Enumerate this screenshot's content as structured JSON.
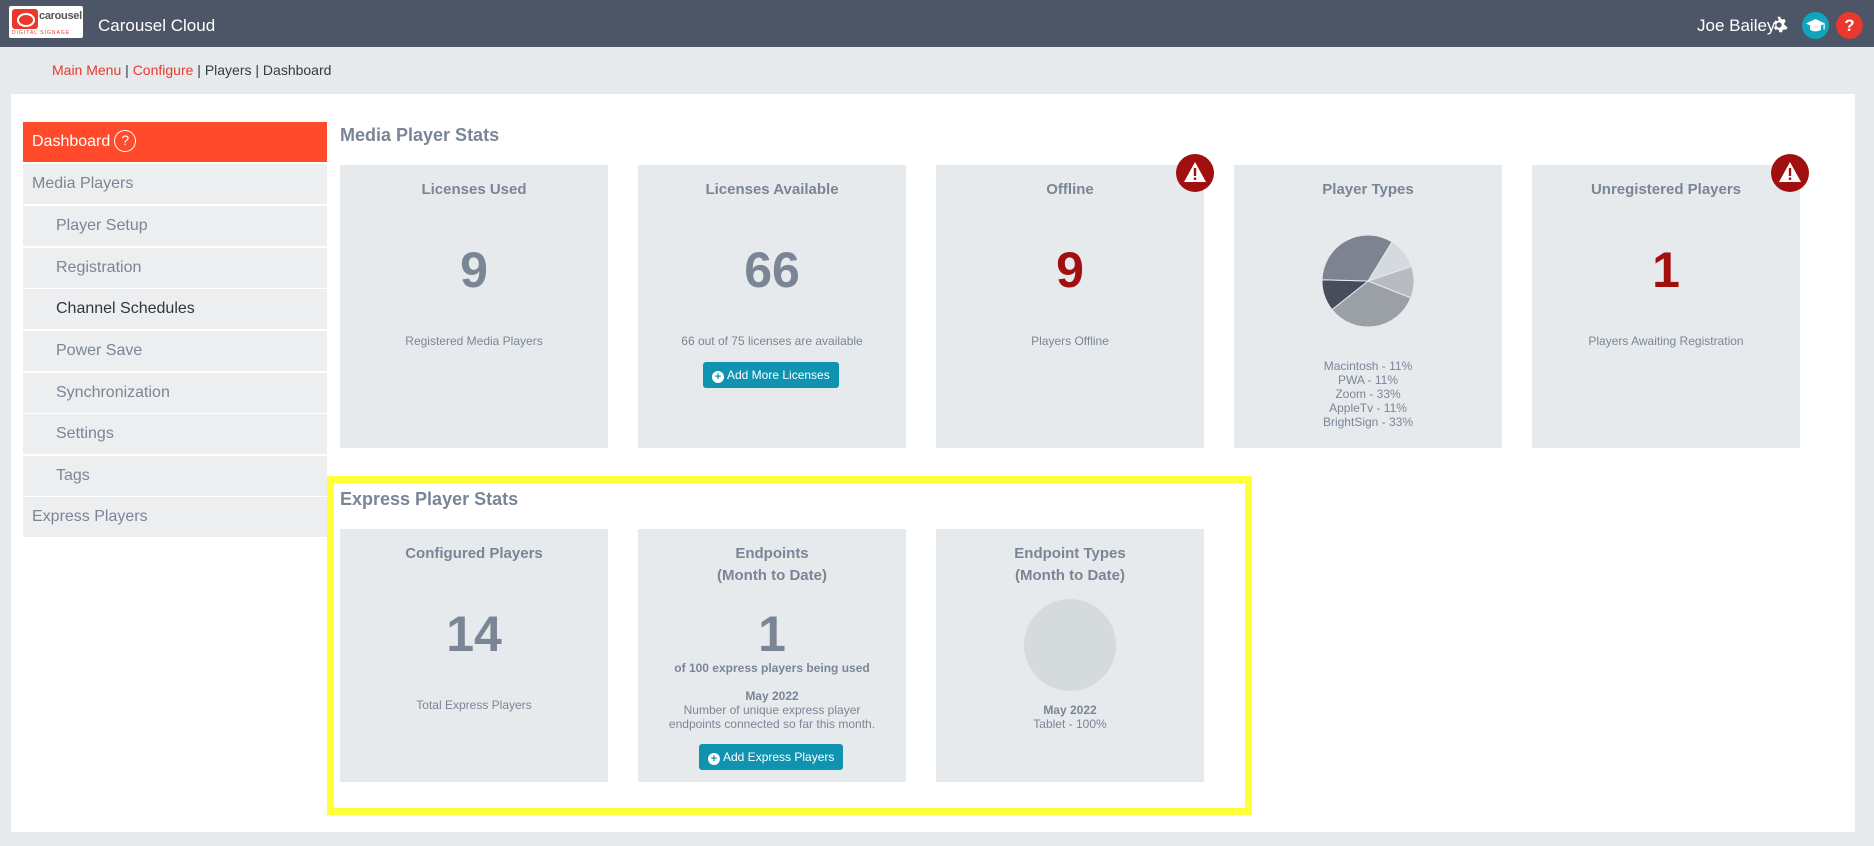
{
  "header": {
    "logo_text": "carousel",
    "logo_subtext": "DIGITAL SIGNAGE",
    "app_title": "Carousel Cloud",
    "user_name": "Joe Bailey",
    "help_glyph": "?",
    "icons": [
      "carousel-logo-icon",
      "gear-icon",
      "graduation-cap-icon",
      "question-icon"
    ],
    "colors": {
      "bar": "#4d5666",
      "edu": "#10a4bd",
      "help": "#e8392c"
    }
  },
  "breadcrumb": {
    "main_menu": "Main Menu",
    "configure": "Configure",
    "players": "Players",
    "current": "Dashboard",
    "separator": "|"
  },
  "sidebar": {
    "items": [
      {
        "label": "Dashboard",
        "active": true
      },
      {
        "label": "Media Players"
      },
      {
        "label": "Player Setup"
      },
      {
        "label": "Registration"
      },
      {
        "label": "Channel Schedules"
      },
      {
        "label": "Power Save"
      },
      {
        "label": "Synchronization"
      },
      {
        "label": "Settings"
      },
      {
        "label": "Tags"
      },
      {
        "label": "Express Players"
      }
    ],
    "help_glyph": "?",
    "active_color": "#ff4b2b"
  },
  "media_stats": {
    "title": "Media Player Stats",
    "licenses_used": {
      "title": "Licenses Used",
      "value": "9",
      "caption": "Registered Media Players"
    },
    "licenses_available": {
      "title": "Licenses Available",
      "value": "66",
      "caption": "66 out of 75 licenses are available",
      "button": "Add More Licenses"
    },
    "offline": {
      "title": "Offline",
      "value": "9",
      "caption": "Players Offline"
    },
    "player_types": {
      "title": "Player Types",
      "legend": [
        "Macintosh - 11%",
        "PWA - 11%",
        "Zoom - 33%",
        "AppleTv - 11%",
        "BrightSign - 33%"
      ]
    },
    "unregistered": {
      "title": "Unregistered Players",
      "value": "1",
      "caption": "Players Awaiting Registration"
    },
    "warning_color": "#a10f0f"
  },
  "chart_data": {
    "type": "pie",
    "categories": [
      "Macintosh",
      "PWA",
      "Zoom",
      "AppleTv",
      "BrightSign"
    ],
    "values": [
      11,
      11,
      33,
      11,
      33
    ],
    "colors": [
      "#d5dadf",
      "#b6bcc2",
      "#9aa0a6",
      "#474e5b",
      "#7d8390"
    ]
  },
  "express_stats": {
    "title": "Express Player Stats",
    "configured": {
      "title": "Configured Players",
      "value": "14",
      "caption": "Total Express Players"
    },
    "endpoints": {
      "title_line1": "Endpoints",
      "title_line2": "(Month to Date)",
      "value": "1",
      "usage": "of 100 express players being used",
      "month": "May 2022",
      "desc_line1": "Number of unique express player",
      "desc_line2": "endpoints connected so far this month.",
      "button": "Add Express Players"
    },
    "endpoint_types": {
      "title_line1": "Endpoint Types",
      "title_line2": "(Month to Date)",
      "month": "May 2022",
      "breakdown": "Tablet - 100%"
    },
    "highlight_color": "#ffff3a"
  }
}
